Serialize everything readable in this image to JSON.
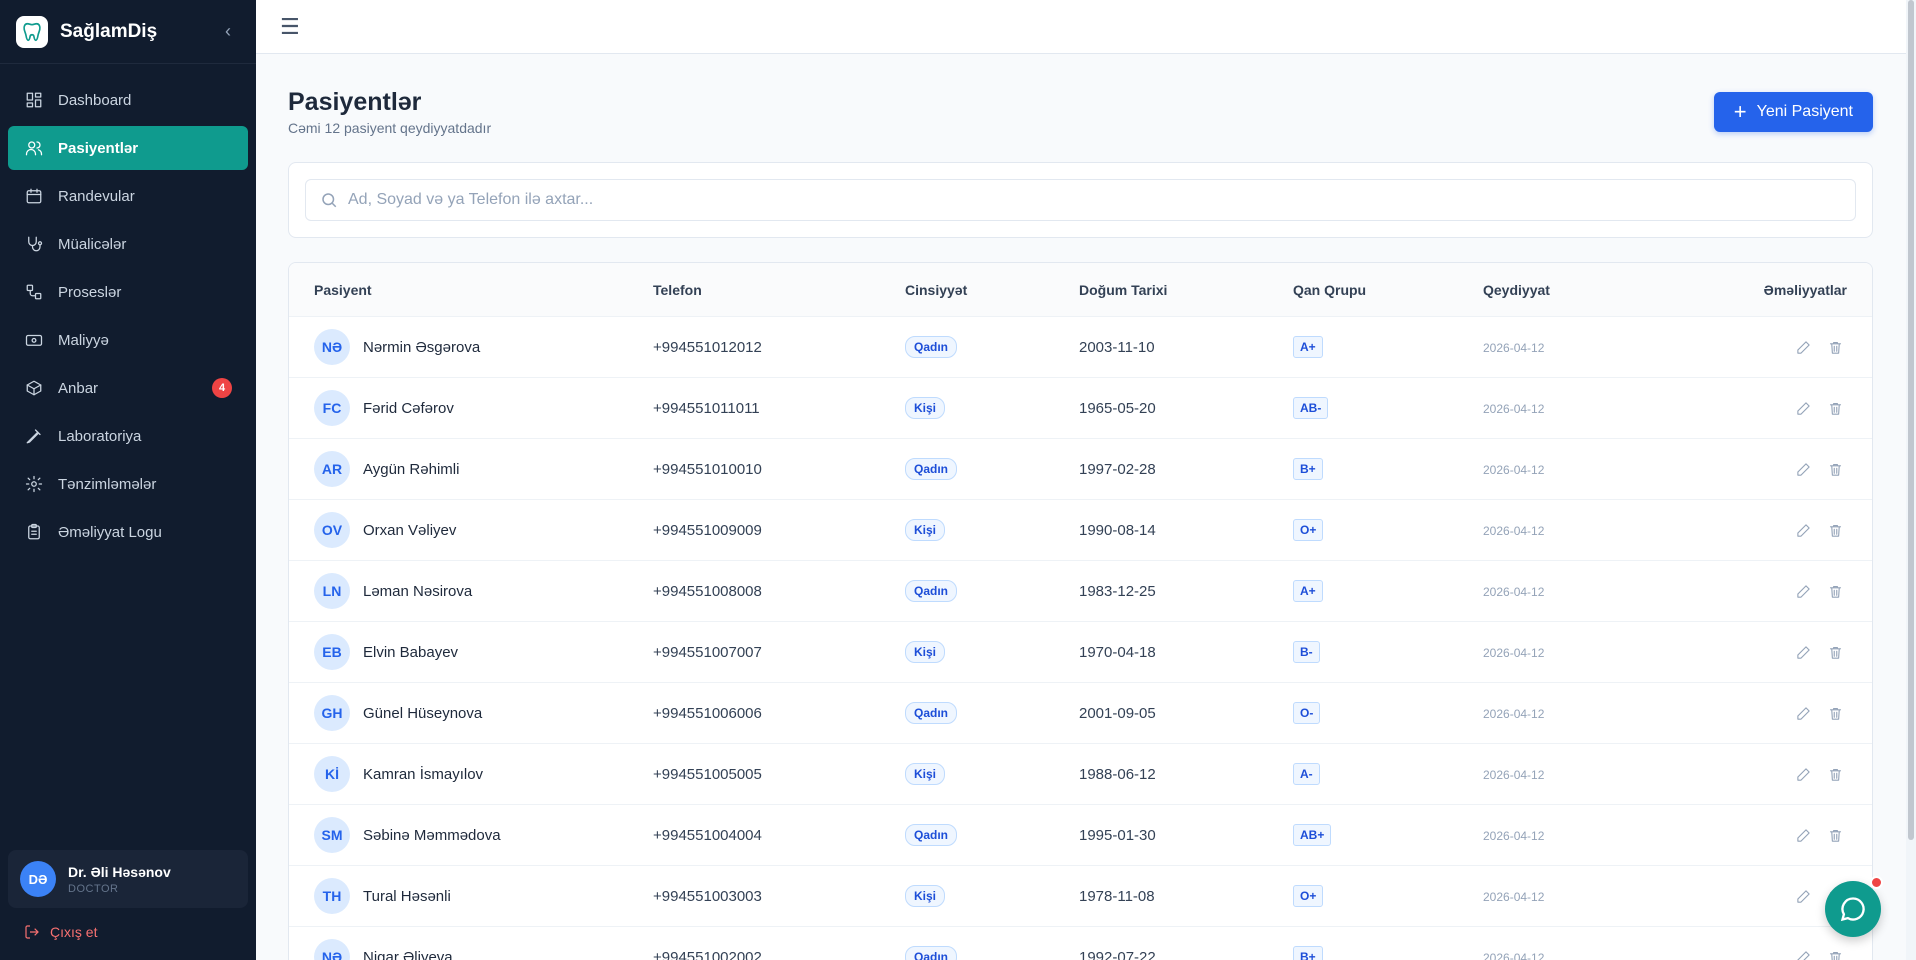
{
  "app": {
    "brand": "SağlamDiş"
  },
  "sidebar": {
    "items": [
      {
        "label": "Dashboard",
        "icon": "dashboard-icon"
      },
      {
        "label": "Pasiyentlər",
        "icon": "users-icon",
        "active": true
      },
      {
        "label": "Randevular",
        "icon": "calendar-icon"
      },
      {
        "label": "Müalicələr",
        "icon": "stethoscope-icon"
      },
      {
        "label": "Proseslər",
        "icon": "workflow-icon"
      },
      {
        "label": "Maliyyə",
        "icon": "wallet-icon"
      },
      {
        "label": "Anbar",
        "icon": "box-icon",
        "badge": "4"
      },
      {
        "label": "Laboratoriya",
        "icon": "pipette-icon"
      },
      {
        "label": "Tənzimləmələr",
        "icon": "gear-icon"
      },
      {
        "label": "Əməliyyat Logu",
        "icon": "clipboard-icon"
      }
    ],
    "user": {
      "initials": "DƏ",
      "name": "Dr. Əli Həsənov",
      "role": "DOCTOR"
    },
    "logout_label": "Çıxış et"
  },
  "page": {
    "title": "Pasiyentlər",
    "subtitle": "Cəmi 12 pasiyent qeydiyyatdadır",
    "new_button_label": "Yeni Pasiyent"
  },
  "search": {
    "placeholder": "Ad, Soyad və ya Telefon ilə axtar..."
  },
  "table": {
    "headers": {
      "name": "Pasiyent",
      "phone": "Telefon",
      "gender": "Cinsiyyət",
      "dob": "Doğum Tarixi",
      "blood": "Qan Qrupu",
      "registered": "Qeydiyyat",
      "actions": "Əməliyyatlar"
    },
    "rows": [
      {
        "initials": "NƏ",
        "name": "Nərmin Əsgərova",
        "phone": "+994551012012",
        "gender": "Qadın",
        "dob": "2003-11-10",
        "blood": "A+",
        "registered": "2026-04-12"
      },
      {
        "initials": "FC",
        "name": "Fərid Cəfərov",
        "phone": "+994551011011",
        "gender": "Kişi",
        "dob": "1965-05-20",
        "blood": "AB-",
        "registered": "2026-04-12"
      },
      {
        "initials": "AR",
        "name": "Aygün Rəhimli",
        "phone": "+994551010010",
        "gender": "Qadın",
        "dob": "1997-02-28",
        "blood": "B+",
        "registered": "2026-04-12"
      },
      {
        "initials": "OV",
        "name": "Orxan Vəliyev",
        "phone": "+994551009009",
        "gender": "Kişi",
        "dob": "1990-08-14",
        "blood": "O+",
        "registered": "2026-04-12"
      },
      {
        "initials": "LN",
        "name": "Ləman Nəsirova",
        "phone": "+994551008008",
        "gender": "Qadın",
        "dob": "1983-12-25",
        "blood": "A+",
        "registered": "2026-04-12"
      },
      {
        "initials": "EB",
        "name": "Elvin Babayev",
        "phone": "+994551007007",
        "gender": "Kişi",
        "dob": "1970-04-18",
        "blood": "B-",
        "registered": "2026-04-12"
      },
      {
        "initials": "GH",
        "name": "Günel Hüseynova",
        "phone": "+994551006006",
        "gender": "Qadın",
        "dob": "2001-09-05",
        "blood": "O-",
        "registered": "2026-04-12"
      },
      {
        "initials": "Kİ",
        "name": "Kamran İsmayılov",
        "phone": "+994551005005",
        "gender": "Kişi",
        "dob": "1988-06-12",
        "blood": "A-",
        "registered": "2026-04-12"
      },
      {
        "initials": "SM",
        "name": "Səbinə Məmmədova",
        "phone": "+994551004004",
        "gender": "Qadın",
        "dob": "1995-01-30",
        "blood": "AB+",
        "registered": "2026-04-12"
      },
      {
        "initials": "TH",
        "name": "Tural Həsənli",
        "phone": "+994551003003",
        "gender": "Kişi",
        "dob": "1978-11-08",
        "blood": "O+",
        "registered": "2026-04-12"
      },
      {
        "initials": "NƏ",
        "name": "Nigar Əliyeva",
        "phone": "+994551002002",
        "gender": "Qadın",
        "dob": "1992-07-22",
        "blood": "B+",
        "registered": "2026-04-12"
      }
    ]
  },
  "colors": {
    "sidebar_bg": "#111c2e",
    "active_nav": "#0f9b8e",
    "primary": "#2563eb",
    "danger": "#ef4444"
  }
}
